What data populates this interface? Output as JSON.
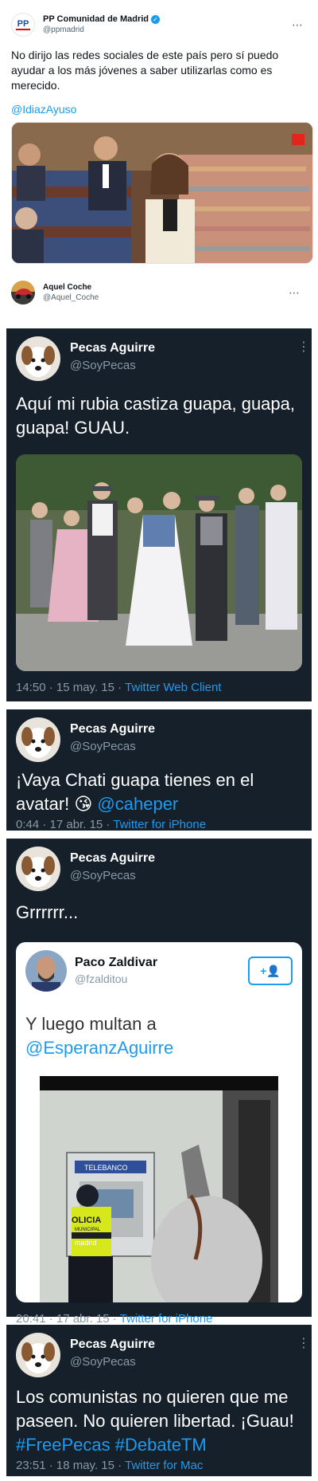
{
  "top_tweet": {
    "logo_text": "PP",
    "name": "PP Comunidad de Madrid",
    "handle": "@ppmadrid",
    "text": "No dirijo las redes sociales de este país pero sí puedo ayudar a los más jóvenes a saber utilizarlas como es merecido.",
    "mention": "@IdiazAyuso",
    "more_icon": "⋯"
  },
  "reply": {
    "name": "Aquel Coche",
    "handle": "@Aquel_Coche",
    "more_icon": "⋯"
  },
  "tweets": [
    {
      "name": "Pecas Aguirre",
      "handle": "@SoyPecas",
      "text": "Aquí mi rubia castiza guapa, guapa, guapa! GUAU.",
      "time": "14:50 · 15 may. 15 · ",
      "client": "Twitter Web Client"
    },
    {
      "name": "Pecas Aguirre",
      "handle": "@SoyPecas",
      "text_pre": "¡Vaya Chati guapa tienes en el avatar! 😘 ",
      "mention": "@caheper",
      "time": "0:44 · 17 abr. 15 · ",
      "client": "Twitter for iPhone"
    },
    {
      "name": "Pecas Aguirre",
      "handle": "@SoyPecas",
      "text": "Grrrrrr...",
      "time": "20:41 · 17 abr. 15 · ",
      "client": "Twitter for iPhone",
      "quoted": {
        "name": "Paco Zaldivar",
        "handle": "@fzalditou",
        "follow_icon": "+👤",
        "text_pre": "Y luego multan a",
        "mention": "@EsperanzAguirre",
        "photo_sign_top": "TELEBANCO",
        "photo_vest_line1": "OLICIA",
        "photo_vest_line2": "MUNICIPAL",
        "photo_vest_line3": "madrid"
      }
    },
    {
      "name": "Pecas Aguirre",
      "handle": "@SoyPecas",
      "text_pre": "Los comunistas no quieren que me paseen. No quieren libertad. ¡Guau! ",
      "hashtag1": "#FreePecas",
      "hashtag2": "#DebateTM",
      "time": "23:51 · 18 may. 15 · ",
      "client": "Twitter for Mac"
    }
  ],
  "colors": {
    "dark_bg": "#15202b",
    "link": "#1d9bf0",
    "muted": "#8899a6"
  }
}
